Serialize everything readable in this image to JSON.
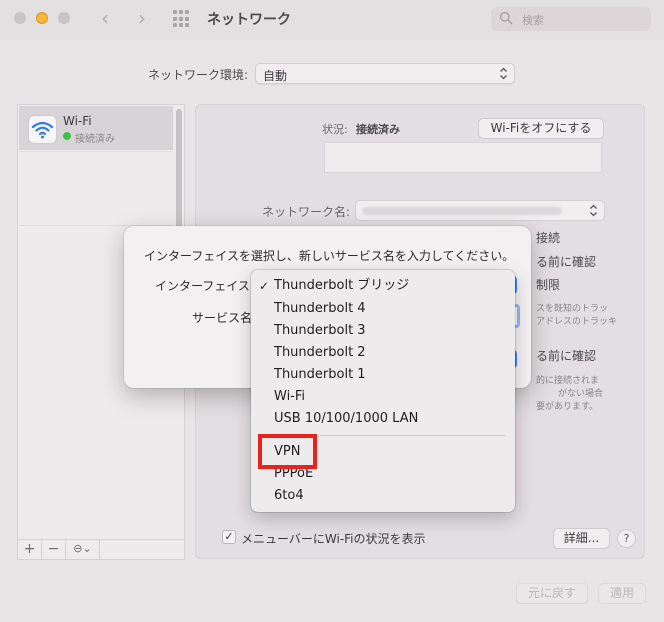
{
  "window": {
    "title": "ネットワーク",
    "search_placeholder": "検索"
  },
  "location": {
    "label": "ネットワーク環境:",
    "value": "自動"
  },
  "sidebar": {
    "items": [
      {
        "name": "Wi-Fi",
        "status": "接続済み"
      }
    ],
    "toolbar": {
      "add": "+",
      "remove": "−",
      "action": "⊖⌄"
    }
  },
  "detail": {
    "status_label": "状況:",
    "status_value": "接続済み",
    "wifi_off_button": "Wi-Fiをオフにする",
    "network_name_label": "ネットワーク名:",
    "fragments": [
      "接続",
      "る前に確認",
      "スを既知のトラッ",
      "アドレスのトラッキ",
      "制限",
      "る前に確認",
      "的に接続されま",
      "がない場合",
      "要があります。"
    ],
    "menubar_checkbox_checked": true,
    "menubar_label": "メニューバーにWi-Fiの状況を表示",
    "details_button": "詳細...",
    "help_button": "?",
    "revert_button": "元に戻す",
    "apply_button": "適用"
  },
  "sheet": {
    "message": "インターフェイスを選択し、新しいサービス名を入力してください。",
    "interface_label": "インターフェイス",
    "service_name_label": "サービス名"
  },
  "menu": {
    "selected": "Thunderbolt ブリッジ",
    "items_group1": [
      "Thunderbolt ブリッジ",
      "Thunderbolt 4",
      "Thunderbolt 3",
      "Thunderbolt 2",
      "Thunderbolt 1",
      "Wi-Fi",
      "USB 10/100/1000 LAN"
    ],
    "items_group2": [
      "VPN",
      "PPPoE",
      "6to4"
    ],
    "highlighted": "VPN"
  },
  "colors": {
    "highlight": "#e8231b",
    "accent": "#3b82f6",
    "connected": "#3fbf4a"
  }
}
